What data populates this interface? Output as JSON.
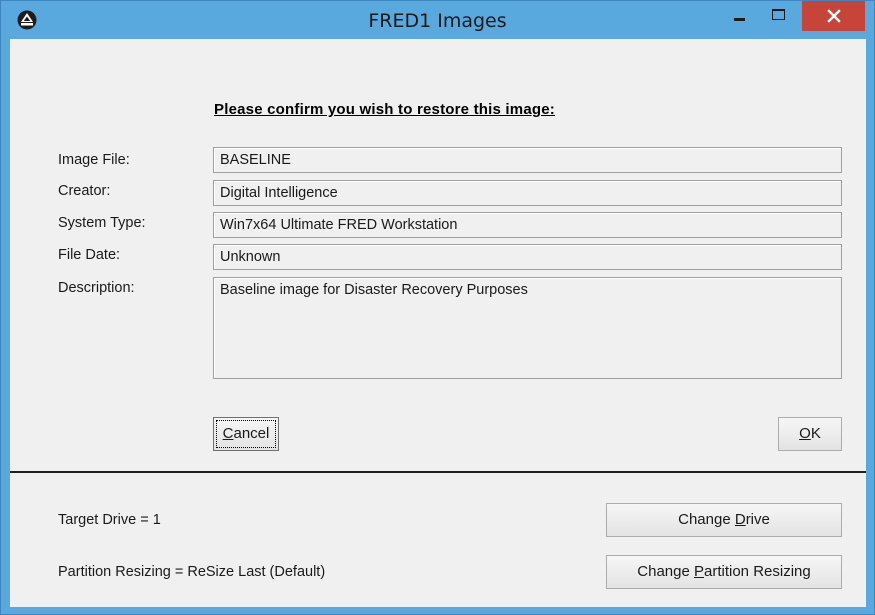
{
  "window": {
    "title": "FRED1 Images",
    "icon": "fred-logo-icon",
    "controls": {
      "minimize": "minimize-icon",
      "maximize": "maximize-icon",
      "close": "close-icon"
    }
  },
  "dialog": {
    "heading": "Please confirm you wish to restore this image:",
    "fields": {
      "image_file": {
        "label": "Image File:",
        "value": "BASELINE"
      },
      "creator": {
        "label": "Creator:",
        "value": "Digital Intelligence"
      },
      "system_type": {
        "label": "System Type:",
        "value": "Win7x64 Ultimate FRED Workstation"
      },
      "file_date": {
        "label": "File Date:",
        "value": "Unknown"
      },
      "description": {
        "label": "Description:",
        "value": "Baseline image for Disaster Recovery Purposes"
      }
    },
    "buttons": {
      "cancel": {
        "mnemonic": "C",
        "rest": "ancel"
      },
      "ok": {
        "mnemonic": "O",
        "rest": "K"
      }
    }
  },
  "footer": {
    "target_drive": "Target Drive = 1",
    "partition_resizing": "Partition Resizing = ReSize Last (Default)",
    "change_drive": {
      "before": "Change ",
      "mnemonic": "D",
      "after": "rive"
    },
    "change_partition_resizing": {
      "before": "Change ",
      "mnemonic": "P",
      "after": "artition Resizing"
    }
  },
  "colors": {
    "title_bar": "#59a8de",
    "close_button": "#c7443a",
    "client_background": "#f0f0f0"
  }
}
